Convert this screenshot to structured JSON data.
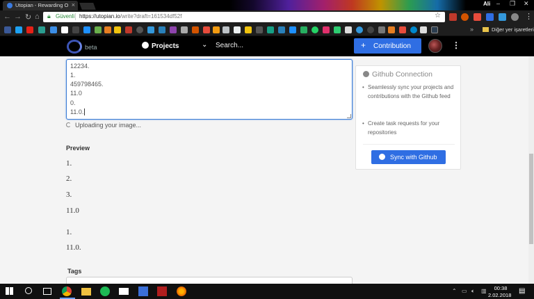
{
  "browser": {
    "tab_title": "Utopian - Rewarding Op",
    "tab_close": "×",
    "window_user": "Ali",
    "secure_label": "Güvenli",
    "url_main": "https://utopian.io",
    "url_path": "/write?draft=161534df52f",
    "other_bookmarks": "Diğer yer işaretleri",
    "more_bookmarks": "»"
  },
  "header": {
    "logo_suffix": "beta",
    "projects_label": "Projects",
    "search_placeholder": "Search...",
    "contribution_label": "Contribution",
    "contribution_plus": "+"
  },
  "editor": {
    "lines": [
      "12234.",
      "1.",
      "459798465.",
      "11.0",
      "0.",
      "11.0."
    ],
    "upload_status": "Uploading your image..."
  },
  "preview": {
    "heading": "Preview",
    "items": [
      "1.",
      "2.",
      "3.",
      "11.0",
      "1.",
      "11.0."
    ]
  },
  "tags": {
    "label": "Tags"
  },
  "github_card": {
    "title": "Github Connection",
    "bullets": [
      "Seamlessly sync your projects and contributions with the Github feed",
      "Create task requests for your repositories"
    ],
    "sync_label": "Sync with Github"
  },
  "taskbar": {
    "time": "00:38",
    "date": "2.02.2018"
  },
  "colors": {
    "accent": "#2f6ee3",
    "header_bg": "#000000",
    "page_bg": "#f4f4f4"
  }
}
